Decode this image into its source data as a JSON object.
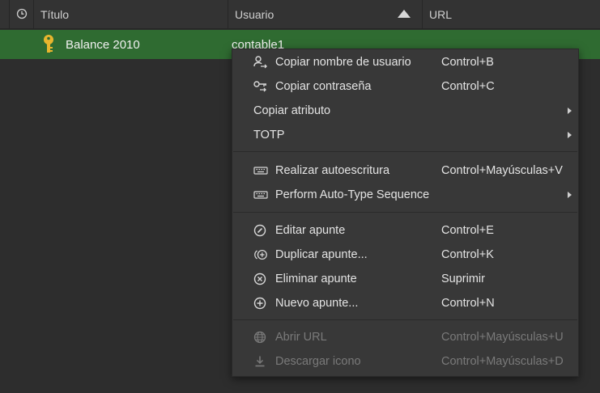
{
  "table": {
    "columns": {
      "title": "Título",
      "username": "Usuario",
      "url": "URL"
    },
    "selected_row": {
      "title": "Balance 2010",
      "username": "contable1"
    }
  },
  "context_menu": {
    "copy_username": {
      "label": "Copiar nombre de usuario",
      "shortcut": "Control+B"
    },
    "copy_password": {
      "label": "Copiar contraseña",
      "shortcut": "Control+C"
    },
    "copy_attribute": {
      "label": "Copiar atributo"
    },
    "totp": {
      "label": "TOTP"
    },
    "autotype": {
      "label": "Realizar autoescritura",
      "shortcut": "Control+Mayúsculas+V"
    },
    "autotype_sequence": {
      "label": "Perform Auto-Type Sequence"
    },
    "edit_entry": {
      "label": "Editar apunte",
      "shortcut": "Control+E"
    },
    "duplicate_entry": {
      "label": "Duplicar apunte...",
      "shortcut": "Control+K"
    },
    "delete_entry": {
      "label": "Eliminar apunte",
      "shortcut": "Suprimir"
    },
    "new_entry": {
      "label": "Nuevo apunte...",
      "shortcut": "Control+N"
    },
    "open_url": {
      "label": "Abrir URL",
      "shortcut": "Control+Mayúsculas+U"
    },
    "download_icon": {
      "label": "Descargar icono",
      "shortcut": "Control+Mayúsculas+D"
    }
  },
  "colors": {
    "selection": "#2f6b31",
    "menu_bg": "#383838",
    "key_icon": "#e8b52e"
  }
}
